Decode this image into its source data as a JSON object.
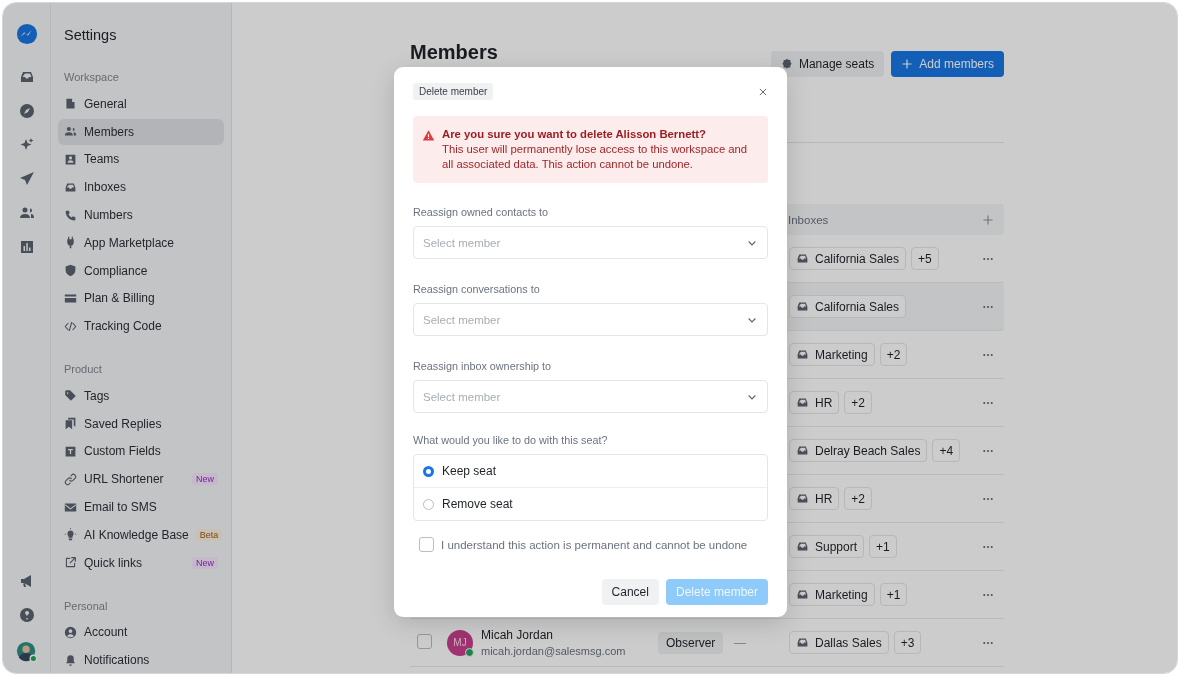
{
  "user": {
    "online": true
  },
  "sidebar": {
    "title": "Settings",
    "sections": [
      {
        "title": "Workspace",
        "items": [
          {
            "label": "General",
            "selected": false
          },
          {
            "label": "Members",
            "selected": true
          },
          {
            "label": "Teams",
            "selected": false
          },
          {
            "label": "Inboxes",
            "selected": false
          },
          {
            "label": "Numbers",
            "selected": false
          },
          {
            "label": "App Marketplace",
            "selected": false
          },
          {
            "label": "Compliance",
            "selected": false
          },
          {
            "label": "Plan & Billing",
            "selected": false
          },
          {
            "label": "Tracking Code",
            "selected": false
          }
        ]
      },
      {
        "title": "Product",
        "items": [
          {
            "label": "Tags",
            "selected": false
          },
          {
            "label": "Saved Replies",
            "selected": false
          },
          {
            "label": "Custom Fields",
            "selected": false
          },
          {
            "label": "URL Shortener",
            "selected": false,
            "badge": {
              "text": "New",
              "kind": "new"
            }
          },
          {
            "label": "Email to SMS",
            "selected": false
          },
          {
            "label": "AI Knowledge Base",
            "selected": false,
            "badge": {
              "text": "Beta",
              "kind": "beta"
            }
          },
          {
            "label": "Quick links",
            "selected": false,
            "badge": {
              "text": "New",
              "kind": "new"
            }
          }
        ]
      },
      {
        "title": "Personal",
        "items": [
          {
            "label": "Account",
            "selected": false
          },
          {
            "label": "Notifications",
            "selected": false
          }
        ]
      }
    ]
  },
  "main": {
    "title": "Members",
    "manage_button": "Manage seats",
    "add_button": "Add members",
    "table": {
      "inboxes_header": "Inboxes",
      "rows": [
        {
          "inbox": "California Sales",
          "extra": "+5",
          "selected": false
        },
        {
          "inbox": "California Sales",
          "selected": true
        },
        {
          "inbox": "Marketing",
          "extra": "+2",
          "selected": false
        },
        {
          "inbox": "HR",
          "extra": "+2",
          "selected": false
        },
        {
          "inbox": "Delray Beach Sales",
          "extra": "+4",
          "selected": false
        },
        {
          "inbox": "HR",
          "extra": "+2",
          "selected": false
        },
        {
          "inbox": "Support",
          "extra": "+1",
          "selected": false
        },
        {
          "inbox": "Marketing",
          "extra": "+1",
          "selected": false
        },
        {
          "inbox": "Dallas Sales",
          "extra": "+3",
          "selected": false,
          "checked": false,
          "initials": "MJ",
          "online": true,
          "name": "Micah Jordan",
          "email": "micah.jordan@salesmsg.com",
          "role": "Observer",
          "team": "—"
        }
      ]
    }
  },
  "modal": {
    "tag": "Delete member",
    "alert_title": "Are you sure you want to delete Alisson Bernett?",
    "alert_body": "This user will permanently lose access to this workspace and all associated data. This action cannot be undone.",
    "selects": [
      {
        "label": "Reassign owned contacts to",
        "placeholder": "Select member"
      },
      {
        "label": "Reassign conversations to",
        "placeholder": "Select member"
      },
      {
        "label": "Reassign inbox ownership to",
        "placeholder": "Select member"
      }
    ],
    "seat_question": "What would you like to do with this seat?",
    "seat_options": [
      {
        "label": "Keep seat",
        "selected": true
      },
      {
        "label": "Remove seat",
        "selected": false
      }
    ],
    "confirm": {
      "label": "I understand this action is permanent and cannot be undone",
      "checked": false
    },
    "cancel": "Cancel",
    "submit": {
      "label": "Delete member",
      "disabled": true
    }
  }
}
